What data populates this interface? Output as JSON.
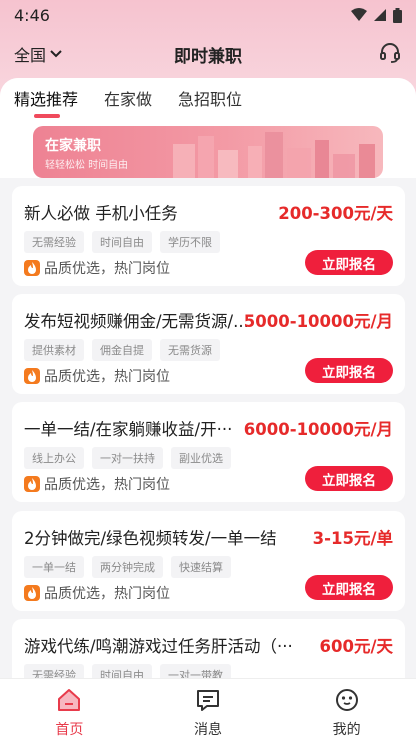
{
  "status": {
    "time": "4:46"
  },
  "header": {
    "region": "全国",
    "title": "即时兼职"
  },
  "tabs": [
    {
      "label": "精选推荐",
      "active": true
    },
    {
      "label": "在家做",
      "active": false
    },
    {
      "label": "急招职位",
      "active": false
    }
  ],
  "banner": {
    "title": "在家兼职",
    "subtitle": "轻轻松松 时间自由"
  },
  "quality_text": "品质优选，热门岗位",
  "apply_label": "立即报名",
  "jobs": [
    {
      "title": "新人必做 手机小任务",
      "salary": "200-300元/天",
      "tags": [
        "无需经验",
        "时间自由",
        "学历不限"
      ]
    },
    {
      "title": "发布短视频赚佣金/无需货源/...",
      "salary": "5000-10000元/月",
      "tags": [
        "提供素材",
        "佣金自提",
        "无需货源"
      ]
    },
    {
      "title": "一单一结/在家躺赚收益/开···",
      "salary": "6000-10000元/月",
      "tags": [
        "线上办公",
        "一对一扶持",
        "副业优选"
      ]
    },
    {
      "title": "2分钟做完/绿色视频转发/一单一结",
      "salary": "3-15元/单",
      "tags": [
        "一单一结",
        "两分钟完成",
        "快速结算"
      ]
    },
    {
      "title": "游戏代练/鸣潮游戏过任务肝活动（···",
      "salary": "600元/天",
      "tags": [
        "无需经验",
        "时间自由",
        "一对一带教"
      ]
    }
  ],
  "nav": [
    {
      "label": "首页",
      "icon": "home-icon",
      "active": true
    },
    {
      "label": "消息",
      "icon": "message-icon",
      "active": false
    },
    {
      "label": "我的",
      "icon": "profile-icon",
      "active": false
    }
  ],
  "colors": {
    "accent": "#ef1f3c",
    "salary": "#e62a2a",
    "nav_active": "#e83b4b"
  }
}
